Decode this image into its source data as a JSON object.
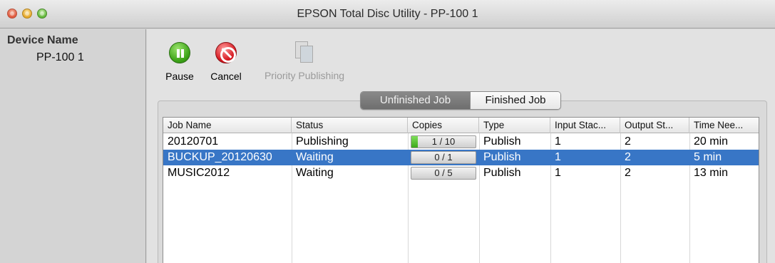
{
  "window": {
    "title": "EPSON Total Disc Utility - PP-100 1"
  },
  "sidebar": {
    "header": "Device Name",
    "items": [
      {
        "label": "PP-100 1",
        "selected": true
      }
    ]
  },
  "toolbar": {
    "pause": {
      "label": "Pause",
      "icon": "pause-icon",
      "enabled": true
    },
    "cancel": {
      "label": "Cancel",
      "icon": "cancel-icon",
      "enabled": true
    },
    "priority": {
      "label": "Priority Publishing",
      "icon": "priority-publishing-icon",
      "enabled": false
    }
  },
  "tabs": [
    {
      "label": "Unfinished Job",
      "active": true
    },
    {
      "label": "Finished Job",
      "active": false
    }
  ],
  "table": {
    "columns": [
      "Job Name",
      "Status",
      "Copies",
      "Type",
      "Input Stac...",
      "Output St...",
      "Time Nee..."
    ],
    "rows": [
      {
        "job_name": "20120701",
        "status": "Publishing",
        "copies": "1 / 10",
        "copies_progress": 0.1,
        "type": "Publish",
        "input_stacker": "1",
        "output_stacker": "2",
        "time_needed": "20 min",
        "selected": false
      },
      {
        "job_name": "BUCKUP_20120630",
        "status": "Waiting",
        "copies": "0 / 1",
        "copies_progress": 0,
        "type": "Publish",
        "input_stacker": "1",
        "output_stacker": "2",
        "time_needed": "5 min",
        "selected": true
      },
      {
        "job_name": "MUSIC2012",
        "status": "Waiting",
        "copies": "0 / 5",
        "copies_progress": 0,
        "type": "Publish",
        "input_stacker": "1",
        "output_stacker": "2",
        "time_needed": "13 min",
        "selected": false
      }
    ]
  },
  "colors": {
    "selection": "#3876c6",
    "progress": "#3ca81a"
  }
}
